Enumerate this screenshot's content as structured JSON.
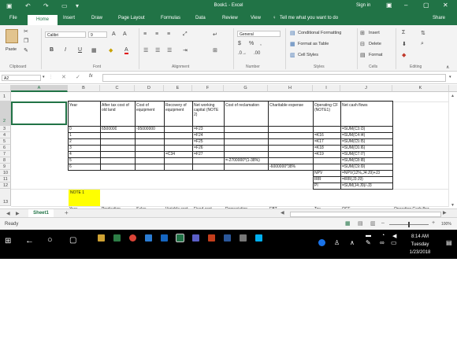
{
  "app": {
    "title": "Book1  -  Excel",
    "signin": "Sign in",
    "share": "Share",
    "tell_me": "Tell me what you want to do"
  },
  "tabs": [
    "File",
    "Home",
    "Insert",
    "Draw",
    "Page Layout",
    "Formulas",
    "Data",
    "Review",
    "View"
  ],
  "ribbon": {
    "paste": "Paste",
    "clipboard": "Clipboard",
    "font_name": "Calibri",
    "font_size": "9",
    "font_group": "Font",
    "alignment_group": "Alignment",
    "number_format": "General",
    "number_group": "Number",
    "conditional_formatting": "Conditional Formatting",
    "format_as_table": "Format as Table",
    "cell_styles": "Cell Styles",
    "styles_group": "Styles",
    "insert": "Insert",
    "delete": "Delete",
    "format": "Format",
    "cells_group": "Cells",
    "editing_group": "Editing",
    "bold": "B",
    "italic": "I",
    "underline": "U",
    "font_color": "A",
    "percent": "%",
    "comma": ",",
    "currency": "$",
    "sigma": "Σ",
    "fx": "fx"
  },
  "formula_bar": {
    "name_box": "A2",
    "formula": ""
  },
  "columns": [
    "A",
    "B",
    "C",
    "D",
    "E",
    "F",
    "G",
    "H",
    "I",
    "J",
    "K"
  ],
  "rows": [
    "1",
    "2",
    "3",
    "4",
    "5",
    "6",
    "7",
    "8",
    "9",
    "10",
    "11",
    "12",
    "13"
  ],
  "cells": {
    "header_year": "Year",
    "header_after_tax": "After tax cost of old land",
    "header_cost_equipment": "Cost of equipment",
    "header_recovery": "Recovery of equipment",
    "header_nwc": "Net working capital (NOTE 2)",
    "header_reclamation": "Cost of reclamation",
    "header_charitable": "Charitable expense",
    "header_ocf": "Operating CF (NOTE1)",
    "header_ncf": "Net cash flows",
    "years": [
      "0",
      "1",
      "2",
      "3",
      "4",
      "5",
      "6"
    ],
    "c3": "6500000",
    "d3": "-95000000",
    "e7": "=C34",
    "f": [
      "=F23",
      "=F24",
      "=F25",
      "=F26",
      "=F27"
    ],
    "g8": "=-2700000*(1-38%)",
    "h9": "-6000000*38%",
    "i": [
      "=K16",
      "=K17",
      "=K18",
      "=K19"
    ],
    "j": [
      "=SUM(C3:I3)",
      "=SUM(C4:I4)",
      "=SUM(C5:I5)",
      "=SUM(C6:I6)",
      "=SUM(C7:I7)",
      "=SUM(C8:I8)",
      "=SUM(C9:I9)"
    ],
    "npv_label": "NPV",
    "irr_label": "IRR",
    "pi_label": "PI",
    "npv": "=NPV(12%,J4:J9)+J3",
    "irr": "=IRR(J3:J9)",
    "pi": "=SUM(J4:J9)/-J3",
    "note1": "NOTE 1"
  },
  "row14_partial": [
    "Year",
    "Production",
    "Sales",
    "Variable cost",
    "Fixed cost",
    "Depreciation",
    "EBT",
    "Tax",
    "OCF",
    "Operating Cash flow"
  ],
  "sheet": {
    "tab": "Sheet1",
    "add": "+"
  },
  "status": {
    "ready": "Ready",
    "zoom": "100%"
  },
  "taskbar": {
    "time": "8:14 AM",
    "day": "Tuesday",
    "date": "1/23/2018"
  },
  "colors": {
    "excel_green": "#217346",
    "note_yellow": "#ffff00"
  }
}
